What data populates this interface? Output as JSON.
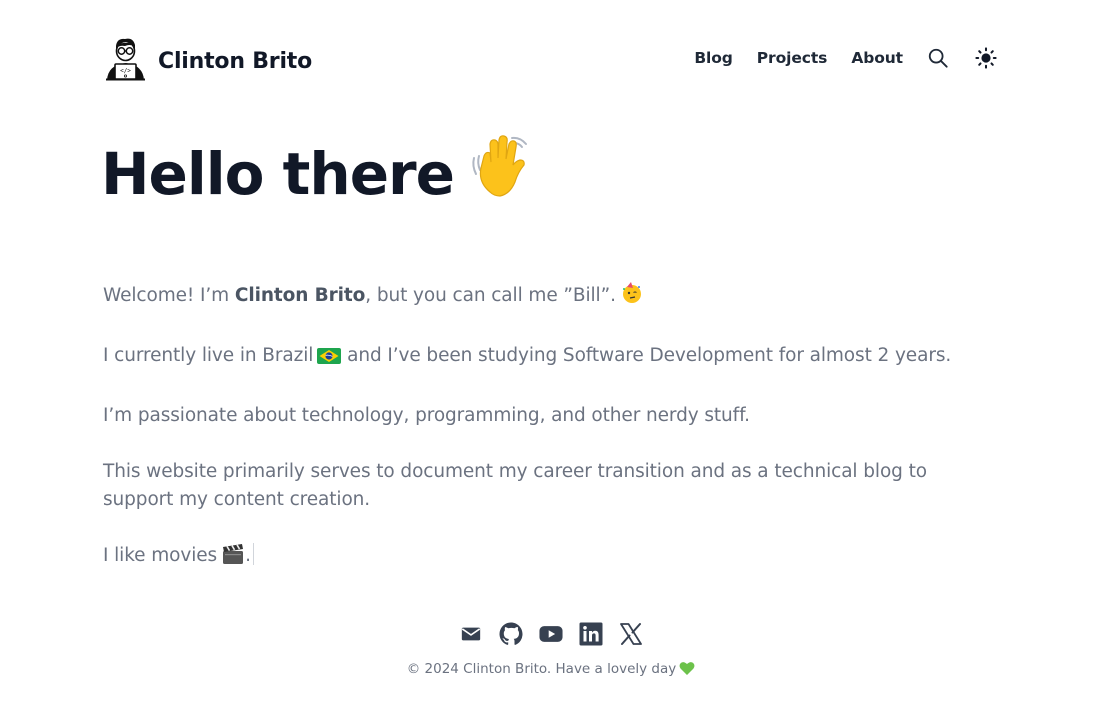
{
  "header": {
    "brand": "Clinton Brito",
    "nav": [
      "Blog",
      "Projects",
      "About"
    ],
    "icons": [
      "search-icon",
      "sun-icon"
    ]
  },
  "hero": {
    "title": "Hello there",
    "emoji": "waving-hand"
  },
  "intro": {
    "p1_before": "Welcome! I’m ",
    "p1_name": "Clinton Brito",
    "p1_after": ", but you can call me ”Bill”.",
    "p2_before": "I currently live in Brazil",
    "p2_after": " and I’ve been studying Software Development for almost 2 years.",
    "p3": "I’m passionate about technology, programming, and other nerdy stuff.",
    "p4": "This website primarily serves to document my career transition and as a technical blog to support my content creation.",
    "p5_before": "I like movies",
    "p5_after": "."
  },
  "socials": [
    "mail-icon",
    "github-icon",
    "youtube-icon",
    "linkedin-icon",
    "x-icon"
  ],
  "footer": {
    "text": "© 2024 Clinton Brito. Have a lovely day"
  },
  "colors": {
    "text": "#111827",
    "muted": "#6b7280",
    "icon": "#374151"
  }
}
